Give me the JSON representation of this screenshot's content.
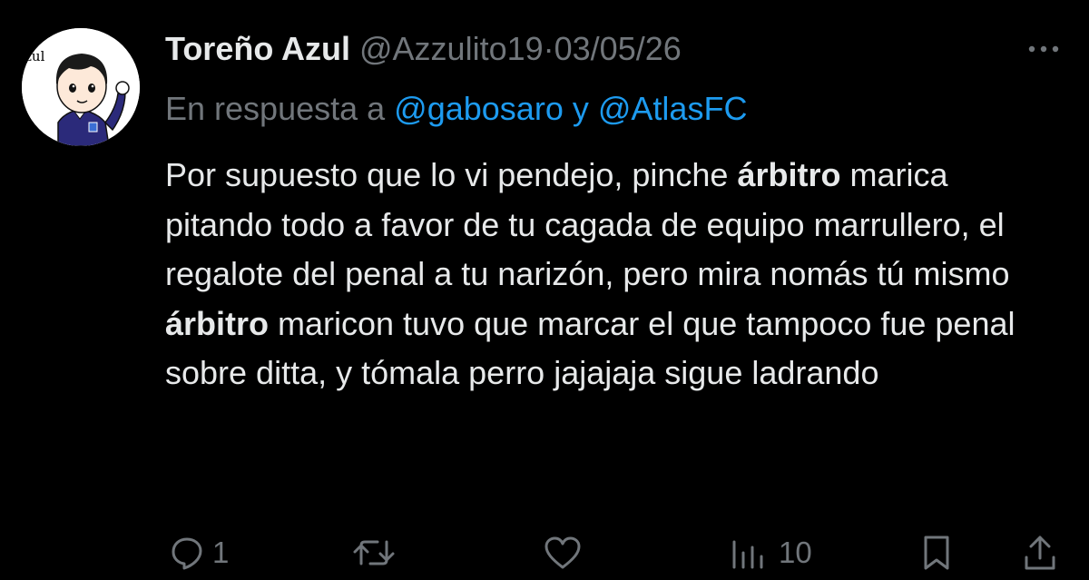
{
  "tweet": {
    "author_name": "Toreño Azul",
    "handle": "@Azzulito19",
    "separator": "·",
    "date": "03/05/26",
    "reply_prefix": "En respuesta a",
    "reply_mention_1": "@gabosaro",
    "reply_conjunction": "y",
    "reply_mention_2": "@AtlasFC",
    "body": [
      "Por supuesto que lo vi pendejo, pinche ",
      "árbitro",
      " marica pitando todo a favor de tu cagada de equipo marrullero, el regalote del penal a tu narizón, pero mira nomás tú mismo ",
      "árbitro",
      " maricon tuvo que marcar el que tampoco fue penal sobre ditta, y tómala perro jajajaja sigue ladrando"
    ],
    "avatar_text": "zul"
  },
  "actions": {
    "reply_count": "1",
    "repost_count": "",
    "like_count": "",
    "views_count": "10"
  },
  "colors": {
    "background": "#000000",
    "text": "#e7e9ea",
    "muted": "#71767b",
    "mention": "#1d9bf0"
  },
  "icons": [
    "reply-icon",
    "repost-icon",
    "like-icon",
    "views-icon",
    "bookmark-icon",
    "share-icon",
    "more-icon"
  ]
}
